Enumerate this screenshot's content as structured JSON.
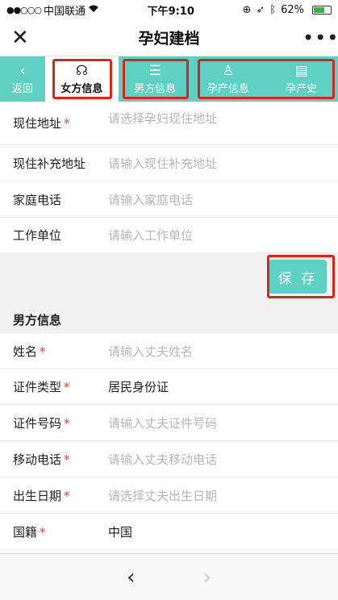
{
  "status": {
    "carrier": "中国联通",
    "time": "下午9:10",
    "battery": "62%"
  },
  "nav": {
    "title": "孕妇建档",
    "close_icon": "close-icon",
    "more_icon": "more-icon"
  },
  "tabs": [
    {
      "label": "返回",
      "icon": "chevron-left-icon"
    },
    {
      "label": "女方信息",
      "icon": "person-icon",
      "active": true
    },
    {
      "label": "男方信息",
      "icon": "document-icon"
    },
    {
      "label": "孕产信息",
      "icon": "person-outline-icon"
    },
    {
      "label": "孕产史",
      "icon": "file-list-icon"
    }
  ],
  "female_fields": [
    {
      "label": "现住地址",
      "required": true,
      "placeholder": "请选择孕妇现住地址"
    },
    {
      "label": "现住补充地址",
      "required": false,
      "placeholder": "请输入现住补充地址"
    },
    {
      "label": "家庭电话",
      "required": false,
      "placeholder": "请输入家庭电话"
    },
    {
      "label": "工作单位",
      "required": false,
      "placeholder": "请输入工作单位"
    }
  ],
  "save_label": "保 存",
  "male_section_title": "男方信息",
  "male_fields": [
    {
      "label": "姓名",
      "required": true,
      "placeholder": "请输入丈夫姓名",
      "value": ""
    },
    {
      "label": "证件类型",
      "required": true,
      "placeholder": "",
      "value": "居民身份证"
    },
    {
      "label": "证件号码",
      "required": true,
      "placeholder": "请输入丈夫证件号码",
      "value": ""
    },
    {
      "label": "移动电话",
      "required": true,
      "placeholder": "请输入丈夫移动电话",
      "value": ""
    },
    {
      "label": "出生日期",
      "required": true,
      "placeholder": "请选择丈夫出生日期",
      "value": ""
    },
    {
      "label": "国籍",
      "required": true,
      "placeholder": "",
      "value": "中国"
    }
  ],
  "required_mark": "*",
  "bottom": {
    "back_icon": "chevron-left-icon",
    "forward_icon": "chevron-right-icon"
  },
  "colors": {
    "accent": "#5fd0c4",
    "highlight": "#d9261c",
    "required": "#e0433a"
  }
}
